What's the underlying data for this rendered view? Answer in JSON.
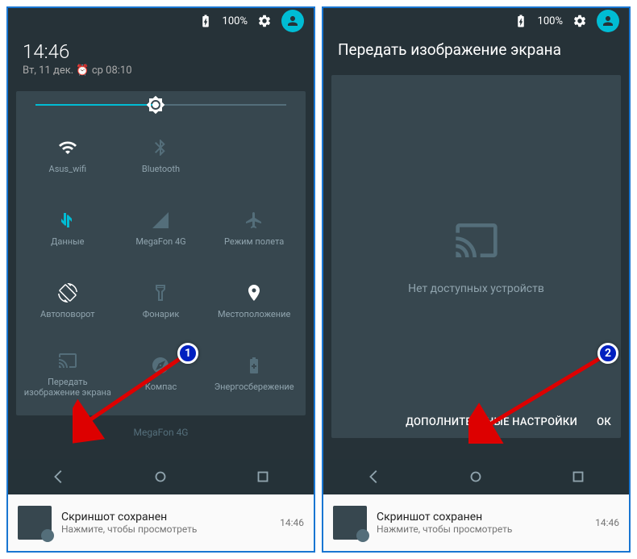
{
  "status": {
    "battery_pct": "100%"
  },
  "left": {
    "time": "14:46",
    "date": "Вт, 11 дек.",
    "alarm": "ср 08:10",
    "brightness_pct": 48,
    "tiles": [
      {
        "label": "Asus_wifi",
        "icon": "wifi",
        "state": "active"
      },
      {
        "label": "Bluetooth",
        "icon": "bluetooth",
        "state": "off"
      },
      {
        "label": "",
        "icon": "",
        "state": "hidden"
      },
      {
        "label": "Данные",
        "icon": "data",
        "state": "accent"
      },
      {
        "label": "MegaFon 4G",
        "icon": "signal",
        "state": "off"
      },
      {
        "label": "Режим полета",
        "icon": "airplane",
        "state": "off"
      },
      {
        "label": "Автоповорот",
        "icon": "autorotate",
        "state": "active"
      },
      {
        "label": "Фонарик",
        "icon": "flashlight",
        "state": "off"
      },
      {
        "label": "Местоположение",
        "icon": "location",
        "state": "active"
      },
      {
        "label": "Передать изображение экрана",
        "icon": "cast",
        "state": "off"
      },
      {
        "label": "Компас",
        "icon": "compass",
        "state": "off"
      },
      {
        "label": "Энергосбережение",
        "icon": "battery-saver",
        "state": "off"
      }
    ],
    "carrier": "MegaFon 4G"
  },
  "right": {
    "title": "Передать изображение экрана",
    "empty_text": "Нет доступных устройств",
    "more_btn": "ДОПОЛНИТЕЛЬНЫЕ НАСТРОЙКИ",
    "ok_btn": "ОК"
  },
  "notif": {
    "title": "Скриншот сохранен",
    "subtitle": "Нажмите, чтобы просмотреть",
    "time": "14:46"
  },
  "annotations": {
    "marker1": "1",
    "marker2": "2"
  }
}
